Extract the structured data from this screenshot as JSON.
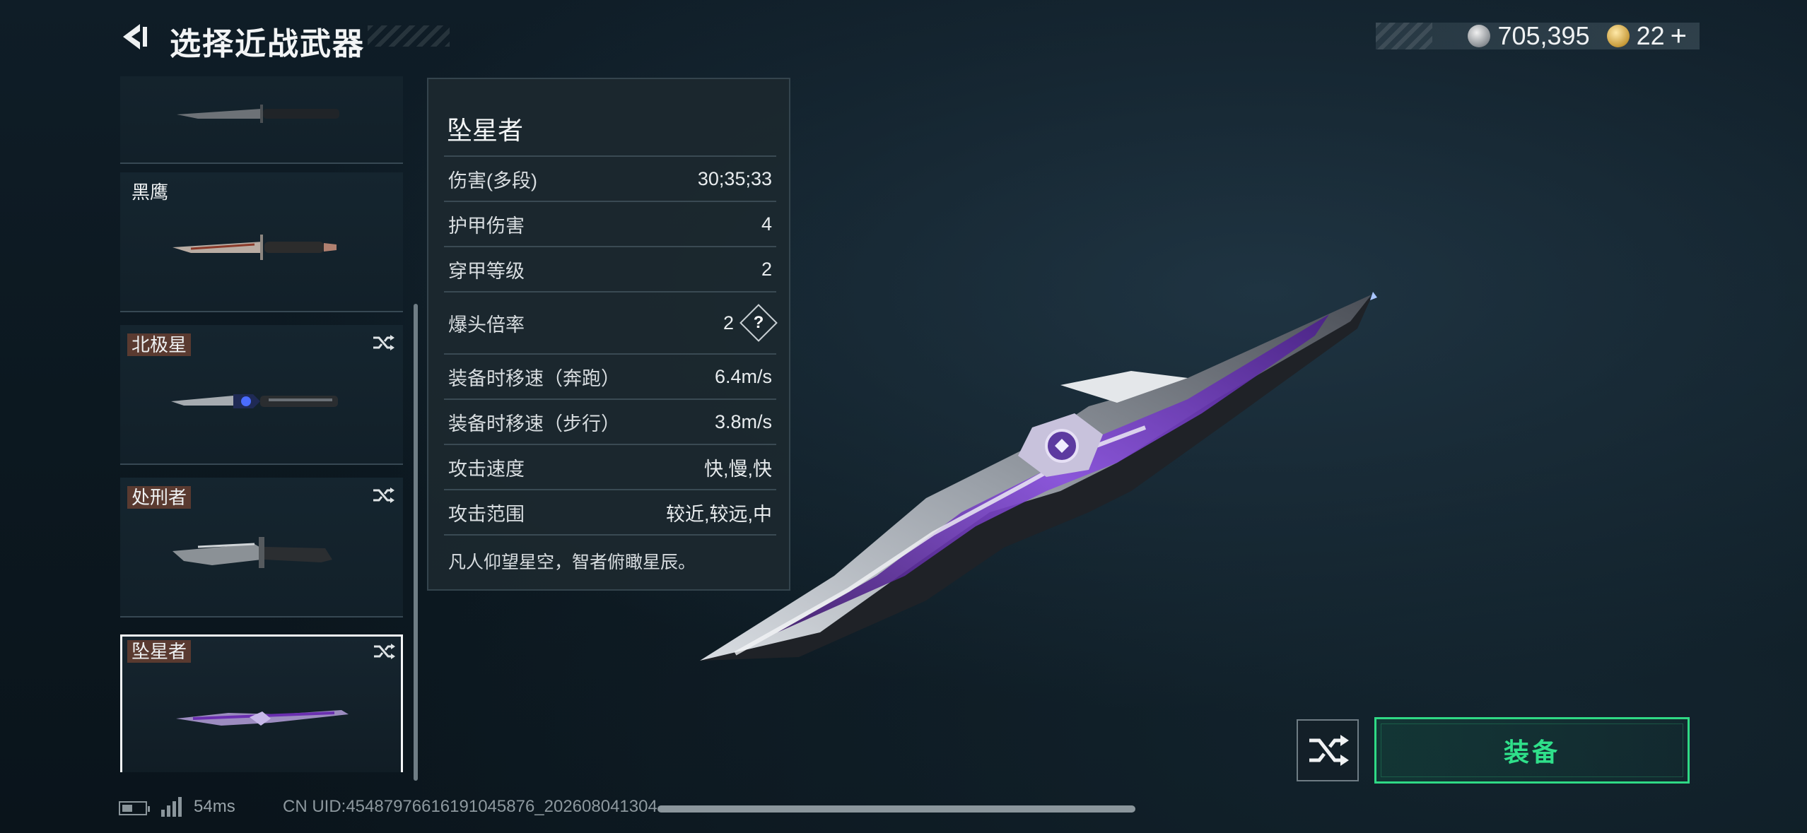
{
  "header": {
    "title": "选择近战武器",
    "currency_silver": "705,395",
    "currency_gold": "22"
  },
  "weapon_list": [
    {
      "name": "",
      "tagged": false,
      "shuffle": false
    },
    {
      "name": "黑鹰",
      "tagged": false,
      "shuffle": false
    },
    {
      "name": "北极星",
      "tagged": true,
      "shuffle": true
    },
    {
      "name": "处刑者",
      "tagged": true,
      "shuffle": true
    },
    {
      "name": "坠星者",
      "tagged": true,
      "shuffle": true,
      "selected": true
    }
  ],
  "stats_panel": {
    "name": "坠星者",
    "rows": [
      {
        "label": "伤害(多段)",
        "value": "30;35;33"
      },
      {
        "label": "护甲伤害",
        "value": "4"
      },
      {
        "label": "穿甲等级",
        "value": "2"
      },
      {
        "label": "爆头倍率",
        "value": "2",
        "help": "?"
      },
      {
        "label": "装备时移速（奔跑）",
        "value": "6.4m/s"
      },
      {
        "label": "装备时移速（步行）",
        "value": "3.8m/s"
      },
      {
        "label": "攻击速度",
        "value": "快,慢,快"
      },
      {
        "label": "攻击范围",
        "value": "较近,较远,中"
      }
    ],
    "description": "凡人仰望星空，智者俯瞰星辰。"
  },
  "actions": {
    "equip_label": "装备"
  },
  "footer": {
    "ping": "54ms",
    "uid": "CN UID:4548797661619104587­6_202608041304"
  },
  "colors": {
    "accent_green": "#2fd985",
    "tag_brown": "#5a3a30",
    "blade_purple": "#7a3fc0"
  }
}
